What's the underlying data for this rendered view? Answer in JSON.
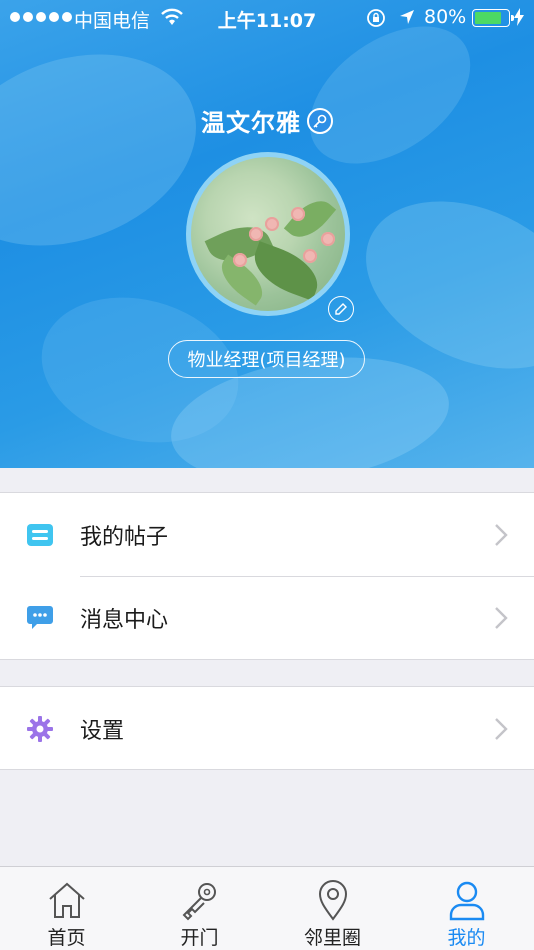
{
  "status_bar": {
    "carrier": "中国电信",
    "time": "上午11:07",
    "battery_percent": "80%",
    "battery_level": 0.8,
    "icons": [
      "signal-dots-icon",
      "wifi-icon",
      "rotation-lock-icon",
      "location-arrow-icon",
      "battery-icon",
      "charging-bolt-icon"
    ]
  },
  "profile": {
    "name": "温文尔雅",
    "role": "物业经理(项目经理)",
    "icons": [
      "key-icon",
      "avatar-photo",
      "edit-pencil-icon"
    ]
  },
  "menu": {
    "group1": [
      {
        "label": "我的帖子",
        "icon": "posts-icon",
        "icon_color": "#40c5f0"
      },
      {
        "label": "消息中心",
        "icon": "chat-bubble-icon",
        "icon_color": "#3f9fe8"
      }
    ],
    "group2": [
      {
        "label": "设置",
        "icon": "gear-icon",
        "icon_color": "#9b74e8"
      }
    ]
  },
  "tabbar": {
    "tabs": [
      {
        "label": "首页",
        "icon": "home-icon"
      },
      {
        "label": "开门",
        "icon": "key-icon"
      },
      {
        "label": "邻里圈",
        "icon": "location-pin-icon"
      },
      {
        "label": "我的",
        "icon": "person-icon"
      }
    ],
    "active_index": 3,
    "active_color": "#1a8af2"
  },
  "colors": {
    "header_blue": "#1e8fe3",
    "page_bg": "#efeff4"
  }
}
